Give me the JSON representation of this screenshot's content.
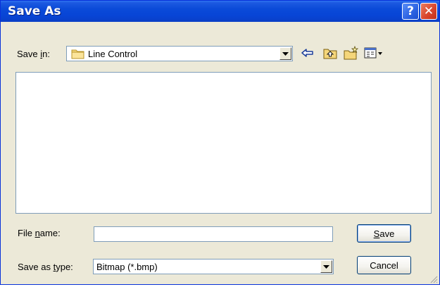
{
  "window": {
    "title": "Save As",
    "help_glyph": "?",
    "close_glyph": "✕"
  },
  "save_in": {
    "label_prefix": "Save ",
    "label_hotkey": "i",
    "label_suffix": "n:",
    "current_folder": "Line Control",
    "folder_icon": "folder-icon"
  },
  "toolbar": {
    "icons": [
      "back-arrow-icon",
      "up-one-level-icon",
      "new-folder-icon",
      "view-menu-icon"
    ]
  },
  "file_name": {
    "label_prefix": "File ",
    "label_hotkey": "n",
    "label_suffix": "ame:",
    "value": ""
  },
  "save_as_type": {
    "label_prefix": "Save as ",
    "label_hotkey": "t",
    "label_suffix": "ype:",
    "selected": "Bitmap (*.bmp)"
  },
  "buttons": {
    "save_hotkey": "S",
    "save_rest": "ave",
    "cancel": "Cancel"
  },
  "colors": {
    "titlebar": "#0a4ad8",
    "dialog_bg": "#ece9d8",
    "close_button": "#d8432a",
    "help_button": "#2d63e2"
  }
}
